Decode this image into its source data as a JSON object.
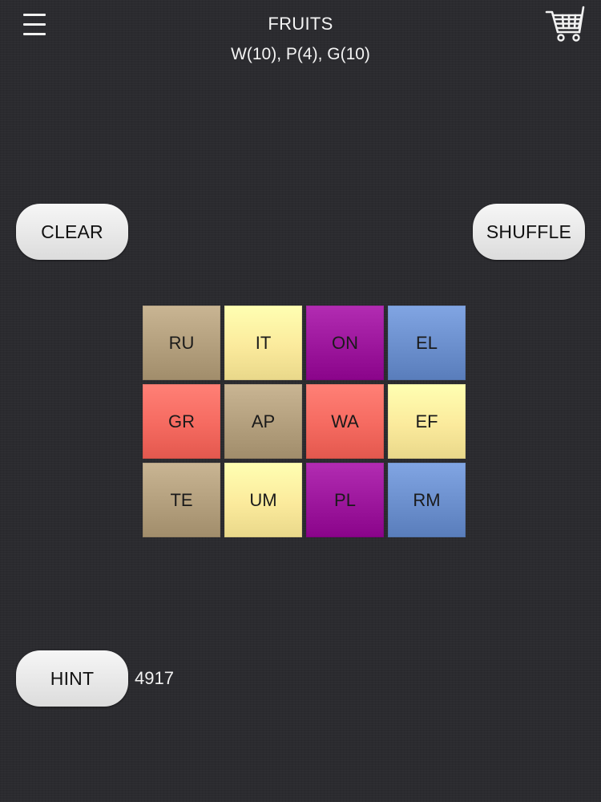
{
  "header": {
    "menu_icon": "hamburger-menu-icon",
    "cart_icon": "shopping-cart-icon",
    "title": "FRUITS",
    "subtitle": "W(10), P(4), G(10)"
  },
  "buttons": {
    "clear": "CLEAR",
    "shuffle": "SHUFFLE",
    "hint": "HINT"
  },
  "hint_count": "4917",
  "colors": {
    "tan": "#b39f7d",
    "yellow": "#fbea9c",
    "purple": "#9c169c",
    "blue": "#6b8fcd",
    "red": "#f56a60",
    "background": "#2b2b2f"
  },
  "tiles": [
    {
      "text": "RU",
      "color": "tan"
    },
    {
      "text": "IT",
      "color": "yellow"
    },
    {
      "text": "ON",
      "color": "purple"
    },
    {
      "text": "EL",
      "color": "blue"
    },
    {
      "text": "GR",
      "color": "red"
    },
    {
      "text": "AP",
      "color": "tan"
    },
    {
      "text": "WA",
      "color": "red"
    },
    {
      "text": "EF",
      "color": "yellow"
    },
    {
      "text": "TE",
      "color": "tan"
    },
    {
      "text": "UM",
      "color": "yellow"
    },
    {
      "text": "PL",
      "color": "purple"
    },
    {
      "text": "RM",
      "color": "blue"
    }
  ]
}
